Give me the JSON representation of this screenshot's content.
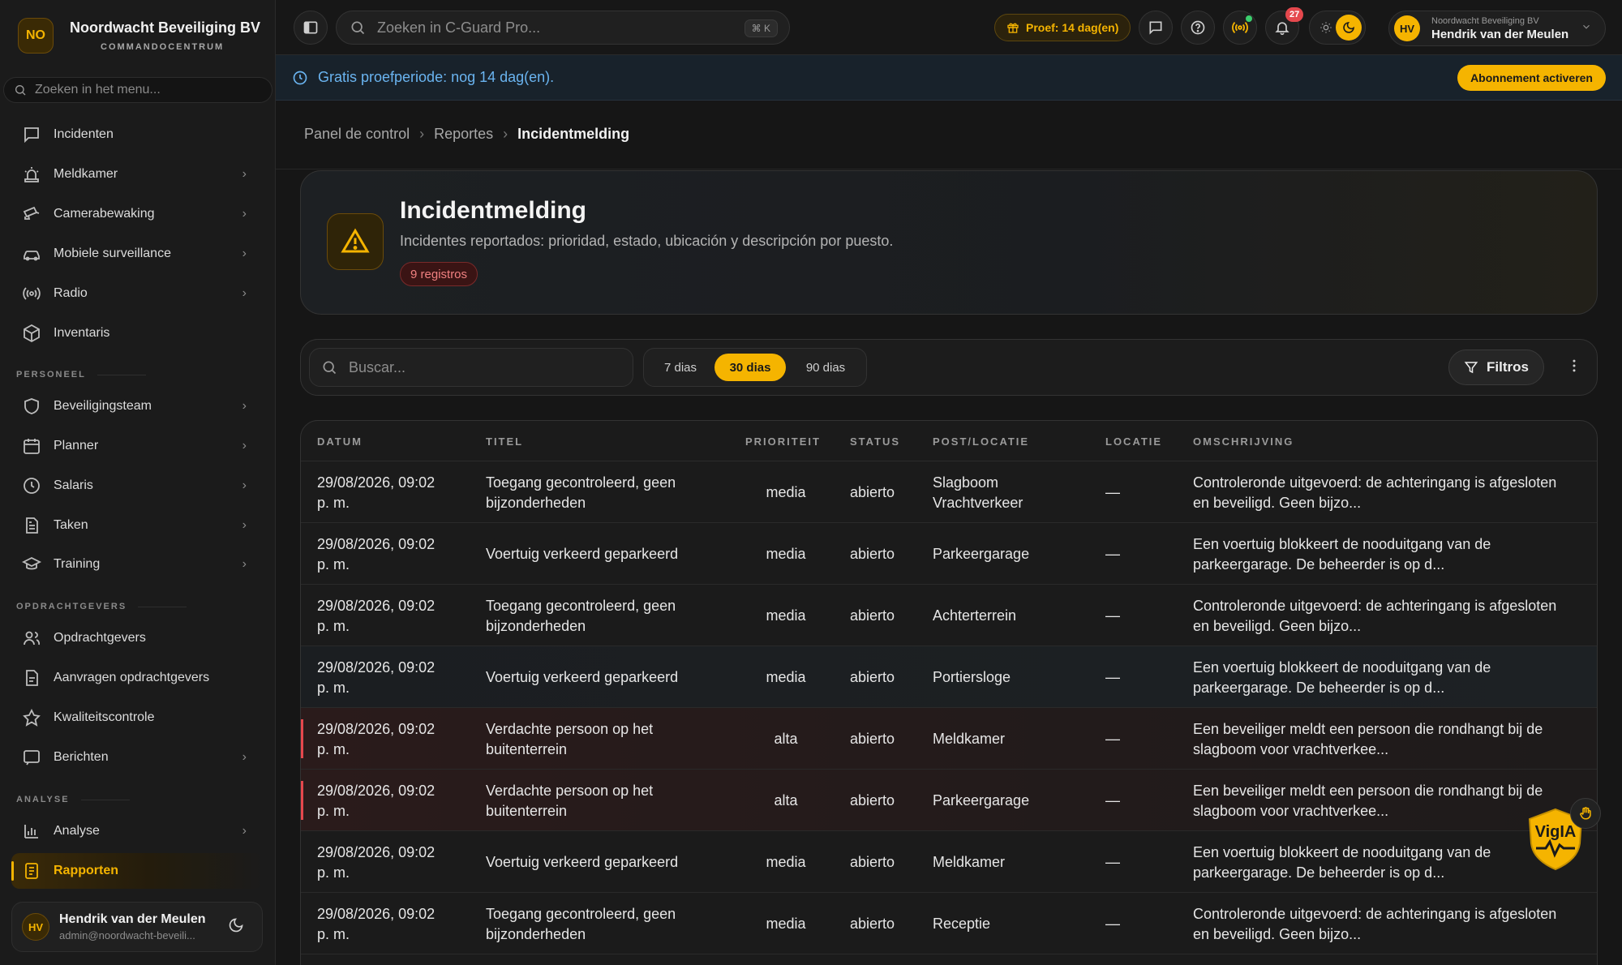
{
  "brand": {
    "initials": "NO",
    "name": "Noordwacht Beveiliging BV",
    "subtitle": "COMMANDOCENTRUM"
  },
  "menu_search": {
    "placeholder": "Zoeken in het menu..."
  },
  "nav": {
    "items_top": [
      {
        "label": "Incidenten",
        "icon": "message-square-icon",
        "chevron": false
      },
      {
        "label": "Meldkamer",
        "icon": "siren-icon",
        "chevron": true
      },
      {
        "label": "Camerabewaking",
        "icon": "cctv-icon",
        "chevron": true
      },
      {
        "label": "Mobiele surveillance",
        "icon": "car-icon",
        "chevron": true
      },
      {
        "label": "Radio",
        "icon": "radio-icon",
        "chevron": true
      },
      {
        "label": "Inventaris",
        "icon": "package-icon",
        "chevron": false
      }
    ],
    "section_personeel": "PERSONEEL",
    "items_personeel": [
      {
        "label": "Beveiligingsteam",
        "icon": "shield-icon",
        "chevron": true
      },
      {
        "label": "Planner",
        "icon": "calendar-icon",
        "chevron": true
      },
      {
        "label": "Salaris",
        "icon": "clock-icon",
        "chevron": true
      },
      {
        "label": "Taken",
        "icon": "file-text-icon",
        "chevron": true
      },
      {
        "label": "Training",
        "icon": "graduation-cap-icon",
        "chevron": true
      }
    ],
    "section_opdrachtgevers": "OPDRACHTGEVERS",
    "items_opdrachtgevers": [
      {
        "label": "Opdrachtgevers",
        "icon": "users-icon",
        "chevron": false
      },
      {
        "label": "Aanvragen opdrachtgevers",
        "icon": "file-icon",
        "chevron": false
      },
      {
        "label": "Kwaliteitscontrole",
        "icon": "star-icon",
        "chevron": false
      },
      {
        "label": "Berichten",
        "icon": "message-icon",
        "chevron": true
      }
    ],
    "section_analyse": "ANALYSE",
    "items_analyse": [
      {
        "label": "Analyse",
        "icon": "bar-chart-icon",
        "chevron": true
      },
      {
        "label": "Rapporten",
        "icon": "report-icon",
        "chevron": false,
        "active": true
      }
    ]
  },
  "user_card": {
    "initials": "HV",
    "name": "Hendrik van der Meulen",
    "email": "admin@noordwacht-beveili..."
  },
  "topbar": {
    "search_placeholder": "Zoeken in C-Guard Pro...",
    "shortcut": "⌘ K",
    "trial_label": "Proef: 14 dag(en)",
    "notification_count": "27",
    "account_org": "Noordwacht Beveiliging BV",
    "account_name": "Hendrik van der Meulen",
    "account_initials": "HV"
  },
  "banner": {
    "text": "Gratis proefperiode: nog 14 dag(en).",
    "button": "Abonnement activeren"
  },
  "breadcrumb": [
    "Panel de control",
    "Reportes",
    "Incidentmelding"
  ],
  "header": {
    "title": "Incidentmelding",
    "subtitle": "Incidentes reportados: prioridad, estado, ubicación y descripción por puesto.",
    "badge": "9 registros"
  },
  "filters": {
    "search_placeholder": "Buscar...",
    "ranges": [
      "7 dias",
      "30 dias",
      "90 dias"
    ],
    "active_range": "30 dias",
    "filter_button": "Filtros"
  },
  "table": {
    "columns": [
      "DATUM",
      "TITEL",
      "PRIORITEIT",
      "STATUS",
      "POST/LOCATIE",
      "LOCATIE",
      "OMSCHRIJVING"
    ],
    "rows": [
      {
        "date1": "29/08/2026, 09:02",
        "date2": "p. m.",
        "title1": "Toegang gecontroleerd, geen",
        "title2": "bijzonderheden",
        "priority": "media",
        "status": "abierto",
        "post1": "Slagboom",
        "post2": "Vrachtverkeer",
        "location": "—",
        "desc1": "Controleronde uitgevoerd: de achteringang is afgesloten",
        "desc2": "en beveiligd. Geen bijzo..."
      },
      {
        "date1": "29/08/2026, 09:02",
        "date2": "p. m.",
        "title1": "Voertuig verkeerd geparkeerd",
        "title2": "",
        "priority": "media",
        "status": "abierto",
        "post1": "Parkeergarage",
        "post2": "",
        "location": "—",
        "desc1": "Een voertuig blokkeert de nooduitgang van de",
        "desc2": "parkeergarage. De beheerder is op d..."
      },
      {
        "date1": "29/08/2026, 09:02",
        "date2": "p. m.",
        "title1": "Toegang gecontroleerd, geen",
        "title2": "bijzonderheden",
        "priority": "media",
        "status": "abierto",
        "post1": "Achterterrein",
        "post2": "",
        "location": "—",
        "desc1": "Controleronde uitgevoerd: de achteringang is afgesloten",
        "desc2": "en beveiligd. Geen bijzo..."
      },
      {
        "date1": "29/08/2026, 09:02",
        "date2": "p. m.",
        "title1": "Voertuig verkeerd geparkeerd",
        "title2": "",
        "priority": "media",
        "status": "abierto",
        "post1": "Portiersloge",
        "post2": "",
        "location": "—",
        "desc1": "Een voertuig blokkeert de nooduitgang van de",
        "desc2": "parkeergarage. De beheerder is op d..."
      },
      {
        "date1": "29/08/2026, 09:02",
        "date2": "p. m.",
        "title1": "Verdachte persoon op het",
        "title2": "buitenterrein",
        "priority": "alta",
        "status": "abierto",
        "post1": "Meldkamer",
        "post2": "",
        "location": "—",
        "desc1": "Een beveiliger meldt een persoon die rondhangt bij de",
        "desc2": "slagboom voor vrachtverkee..."
      },
      {
        "date1": "29/08/2026, 09:02",
        "date2": "p. m.",
        "title1": "Verdachte persoon op het",
        "title2": "buitenterrein",
        "priority": "alta",
        "status": "abierto",
        "post1": "Parkeergarage",
        "post2": "",
        "location": "—",
        "desc1": "Een beveiliger meldt een persoon die rondhangt bij de",
        "desc2": "slagboom voor vrachtverkee..."
      },
      {
        "date1": "29/08/2026, 09:02",
        "date2": "p. m.",
        "title1": "Voertuig verkeerd geparkeerd",
        "title2": "",
        "priority": "media",
        "status": "abierto",
        "post1": "Meldkamer",
        "post2": "",
        "location": "—",
        "desc1": "Een voertuig blokkeert de nooduitgang van de",
        "desc2": "parkeergarage. De beheerder is op d..."
      },
      {
        "date1": "29/08/2026, 09:02",
        "date2": "p. m.",
        "title1": "Toegang gecontroleerd, geen",
        "title2": "bijzonderheden",
        "priority": "media",
        "status": "abierto",
        "post1": "Receptie",
        "post2": "",
        "location": "—",
        "desc1": "Controleronde uitgevoerd: de achteringang is afgesloten",
        "desc2": "en beveiligd. Geen bijzo..."
      }
    ]
  },
  "assistant": {
    "label": "VigIA"
  },
  "colors": {
    "accent": "#f5b400",
    "danger": "#e5484d",
    "info": "#6ab4f0",
    "background": "#161616"
  }
}
